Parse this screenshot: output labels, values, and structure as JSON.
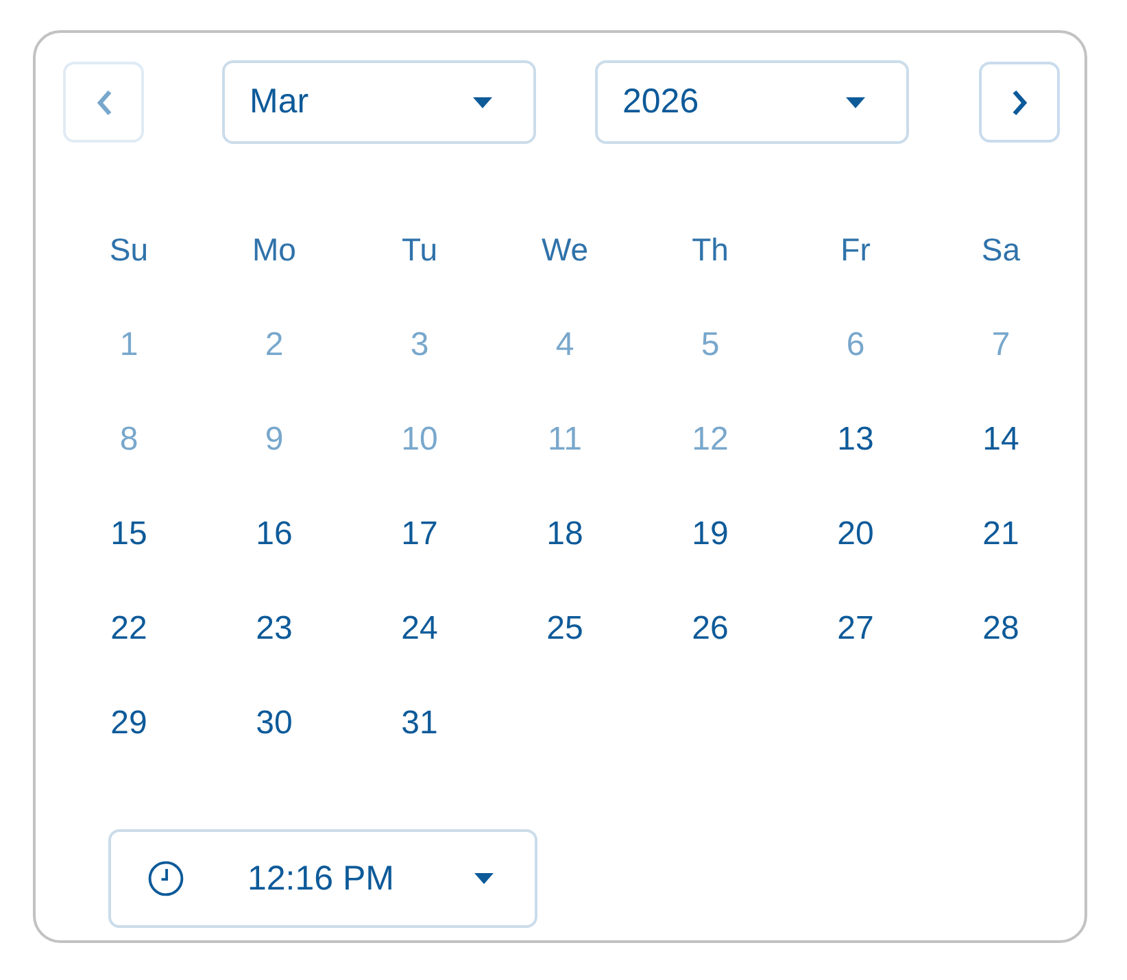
{
  "nav": {
    "prev": {
      "disabled": true
    },
    "next": {
      "disabled": false
    }
  },
  "month_select": {
    "value": "Mar"
  },
  "year_select": {
    "value": "2026"
  },
  "weekdays": [
    "Su",
    "Mo",
    "Tu",
    "We",
    "Th",
    "Fr",
    "Sa"
  ],
  "days": [
    {
      "label": "1",
      "disabled": true
    },
    {
      "label": "2",
      "disabled": true
    },
    {
      "label": "3",
      "disabled": true
    },
    {
      "label": "4",
      "disabled": true
    },
    {
      "label": "5",
      "disabled": true
    },
    {
      "label": "6",
      "disabled": true
    },
    {
      "label": "7",
      "disabled": true
    },
    {
      "label": "8",
      "disabled": true
    },
    {
      "label": "9",
      "disabled": true
    },
    {
      "label": "10",
      "disabled": true
    },
    {
      "label": "11",
      "disabled": true
    },
    {
      "label": "12",
      "disabled": true
    },
    {
      "label": "13",
      "disabled": false
    },
    {
      "label": "14",
      "disabled": false
    },
    {
      "label": "15",
      "disabled": false
    },
    {
      "label": "16",
      "disabled": false
    },
    {
      "label": "17",
      "disabled": false
    },
    {
      "label": "18",
      "disabled": false
    },
    {
      "label": "19",
      "disabled": false
    },
    {
      "label": "20",
      "disabled": false
    },
    {
      "label": "21",
      "disabled": false
    },
    {
      "label": "22",
      "disabled": false
    },
    {
      "label": "23",
      "disabled": false
    },
    {
      "label": "24",
      "disabled": false
    },
    {
      "label": "25",
      "disabled": false
    },
    {
      "label": "26",
      "disabled": false
    },
    {
      "label": "27",
      "disabled": false
    },
    {
      "label": "28",
      "disabled": false
    },
    {
      "label": "29",
      "disabled": false
    },
    {
      "label": "30",
      "disabled": false
    },
    {
      "label": "31",
      "disabled": false
    }
  ],
  "time_select": {
    "value": "12:16 PM"
  }
}
